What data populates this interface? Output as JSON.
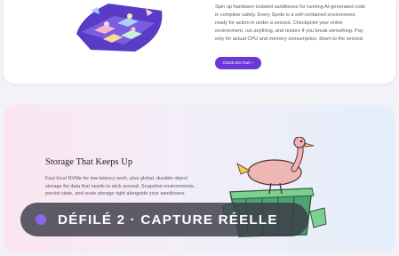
{
  "sprites_section": {
    "description": "Spin up hardware-isolated sandboxes for running AI-generated code in complete safety. Every Sprite is a self-contained environment, ready for action in under a second. Checkpoint your entire environment, run anything, and restore if you break something. Pay only for actual CPU and memory consumption, down to the second.",
    "cta_label": "Check Em Out!",
    "cta_arrow": "›",
    "accent_color": "#6a3ad8"
  },
  "storage_section": {
    "title": "Storage That Keeps Up",
    "description": "Fast local NVMe for low-latency work, plus global, durable object storage for data that needs to stick around. Snapshot environments, persist state, and scale storage right alongside your sandboxes."
  },
  "overlay": {
    "label": "DÉFILÉ 2 · CAPTURE RÉELLE",
    "dot_color": "#8a66ee"
  }
}
